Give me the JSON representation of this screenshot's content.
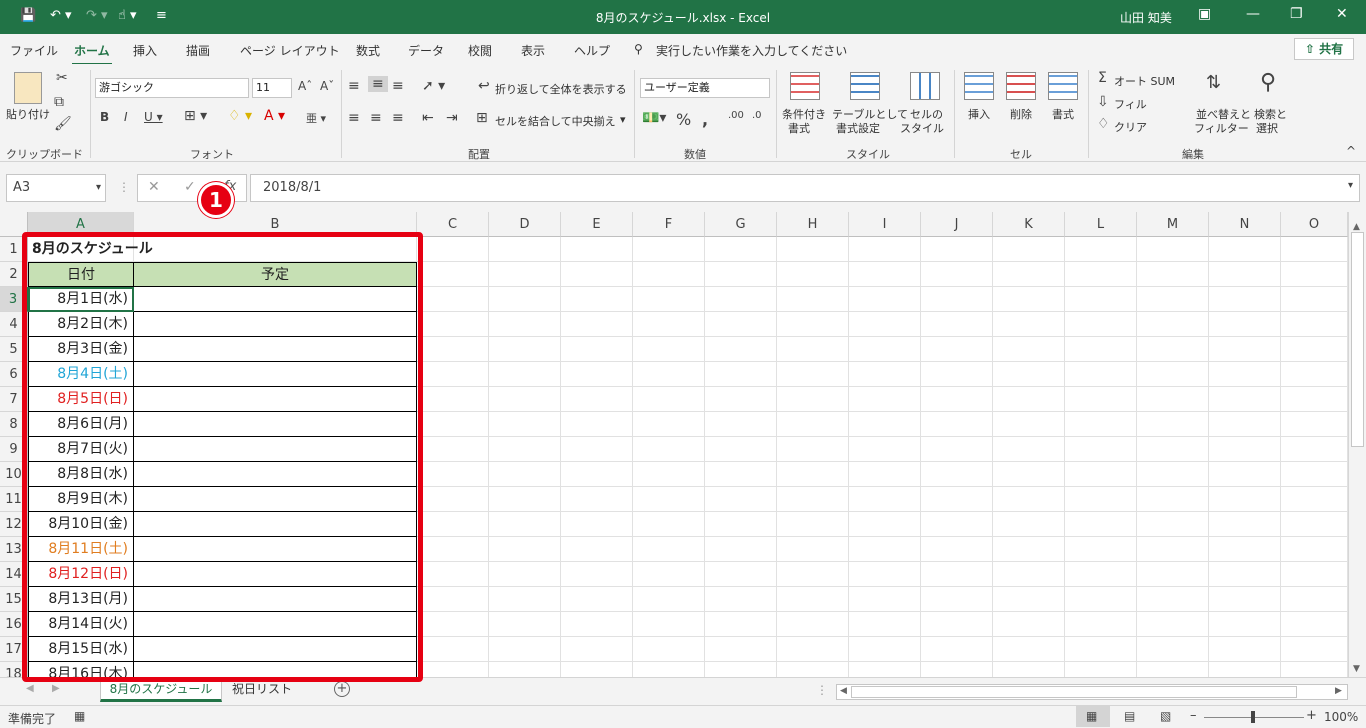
{
  "titlebar": {
    "title": "8月のスケジュール.xlsx  -  Excel",
    "user": "山田 知美"
  },
  "menu": {
    "tabs": [
      "ファイル",
      "ホーム",
      "挿入",
      "描画",
      "ページ レイアウト",
      "数式",
      "データ",
      "校閲",
      "表示",
      "ヘルプ"
    ],
    "tell_me": "実行したい作業を入力してください",
    "share": "共有"
  },
  "ribbon": {
    "clipboard": {
      "paste": "貼り付け",
      "label": "クリップボード"
    },
    "font": {
      "name": "游ゴシック",
      "size": "11",
      "label": "フォント"
    },
    "alignment": {
      "wrap": "折り返して全体を表示する",
      "merge": "セルを結合して中央揃え",
      "label": "配置"
    },
    "number": {
      "format": "ユーザー定義",
      "label": "数値"
    },
    "styles": {
      "conditional_1": "条件付き",
      "conditional_2": "書式",
      "table_1": "テーブルとして",
      "table_2": "書式設定",
      "cell_1": "セルの",
      "cell_2": "スタイル",
      "label": "スタイル"
    },
    "cells": {
      "insert": "挿入",
      "delete": "削除",
      "format": "書式",
      "label": "セル"
    },
    "editing": {
      "autosum": "オート SUM",
      "fill": "フィル",
      "clear": "クリア",
      "sort_1": "並べ替えと",
      "sort_2": "フィルター",
      "find_1": "検索と",
      "find_2": "選択",
      "label": "編集"
    }
  },
  "formula_bar": {
    "name_box": "A3",
    "value": "2018/8/1",
    "callout": "1"
  },
  "grid": {
    "columns": [
      "A",
      "B",
      "C",
      "D",
      "E",
      "F",
      "G",
      "H",
      "I",
      "J",
      "K",
      "L",
      "M",
      "N",
      "O"
    ],
    "rows": [
      "1",
      "2",
      "3",
      "4",
      "5",
      "6",
      "7",
      "8",
      "9",
      "10",
      "11",
      "12",
      "13",
      "14",
      "15",
      "16",
      "17",
      "18"
    ],
    "title": "8月のスケジュール",
    "header_date": "日付",
    "header_plan": "予定",
    "dates": [
      {
        "text": "8月1日(水)",
        "color": "#222222"
      },
      {
        "text": "8月2日(木)",
        "color": "#222222"
      },
      {
        "text": "8月3日(金)",
        "color": "#222222"
      },
      {
        "text": "8月4日(土)",
        "color": "#21a5d6"
      },
      {
        "text": "8月5日(日)",
        "color": "#e02020"
      },
      {
        "text": "8月6日(月)",
        "color": "#222222"
      },
      {
        "text": "8月7日(火)",
        "color": "#222222"
      },
      {
        "text": "8月8日(水)",
        "color": "#222222"
      },
      {
        "text": "8月9日(木)",
        "color": "#222222"
      },
      {
        "text": "8月10日(金)",
        "color": "#222222"
      },
      {
        "text": "8月11日(土)",
        "color": "#e07d20"
      },
      {
        "text": "8月12日(日)",
        "color": "#e02020"
      },
      {
        "text": "8月13日(月)",
        "color": "#222222"
      },
      {
        "text": "8月14日(火)",
        "color": "#222222"
      },
      {
        "text": "8月15日(水)",
        "color": "#222222"
      },
      {
        "text": "8月16日(木)",
        "color": "#222222"
      }
    ],
    "header_fill": "#c6e0b4"
  },
  "sheets": {
    "tabs": [
      "8月のスケジュール",
      "祝日リスト"
    ]
  },
  "status": {
    "ready": "準備完了",
    "zoom": "100%"
  },
  "colors": {
    "brand": "#217346",
    "highlight": "#e60012"
  }
}
